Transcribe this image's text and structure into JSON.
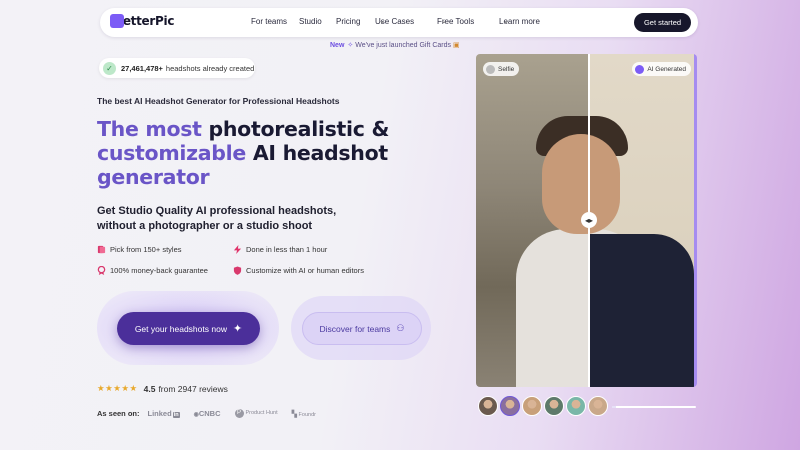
{
  "nav": {
    "logo": "BetterPic",
    "links": [
      {
        "label": "For teams",
        "dropdown": false
      },
      {
        "label": "Studio",
        "dropdown": false
      },
      {
        "label": "Pricing",
        "dropdown": false
      },
      {
        "label": "Use Cases",
        "dropdown": true
      },
      {
        "label": "Free Tools",
        "dropdown": true
      },
      {
        "label": "Learn more",
        "dropdown": true
      }
    ],
    "cta": "Get started"
  },
  "announcement": {
    "badge": "New",
    "text": "We've just launched Gift Cards"
  },
  "counter": {
    "value": "27,461,478+",
    "text": "headshots already created"
  },
  "hero": {
    "subtitle": "The best AI Headshot Generator for Professional Headshots",
    "headline_accent_1": "The most",
    "headline_plain_1": "photorealistic &",
    "headline_accent_2": "customizable",
    "headline_plain_2": "AI headshot",
    "headline_plain_3": "generator",
    "tagline": "Get Studio Quality AI professional headshots, without a photographer or a studio shoot"
  },
  "features": [
    {
      "label": "Pick from 150+ styles",
      "icon": "styles-icon"
    },
    {
      "label": "Done in less than 1 hour",
      "icon": "lightning-icon"
    },
    {
      "label": "100% money-back guarantee",
      "icon": "badge-icon"
    },
    {
      "label": "Customize with AI or human editors",
      "icon": "shield-icon"
    }
  ],
  "buttons": {
    "primary": "Get your headshots now",
    "secondary": "Discover for teams"
  },
  "rating": {
    "stars": "★★★★★",
    "score": "4.5",
    "text": "from 2947 reviews"
  },
  "seen_on": {
    "label": "As seen on:",
    "outlets": [
      "Linked",
      "CNBC",
      "Product Hunt",
      "Foundr"
    ]
  },
  "comparison": {
    "left_label": "Selfie",
    "right_label": "AI Generated",
    "slider_position": 0.51
  },
  "thumbnails": {
    "count": 6,
    "selected_index": 1,
    "colors": [
      "#6b5a4e",
      "#8a6f9e",
      "#c8a07a",
      "#5e7a6a",
      "#79b7a8",
      "#c9a88a"
    ]
  },
  "carousel_progress": 0.05,
  "colors": {
    "accent": "#6a55c7",
    "primary_button": "#4b2f9a",
    "nav_cta": "#17172b",
    "star": "#e8a92c"
  }
}
